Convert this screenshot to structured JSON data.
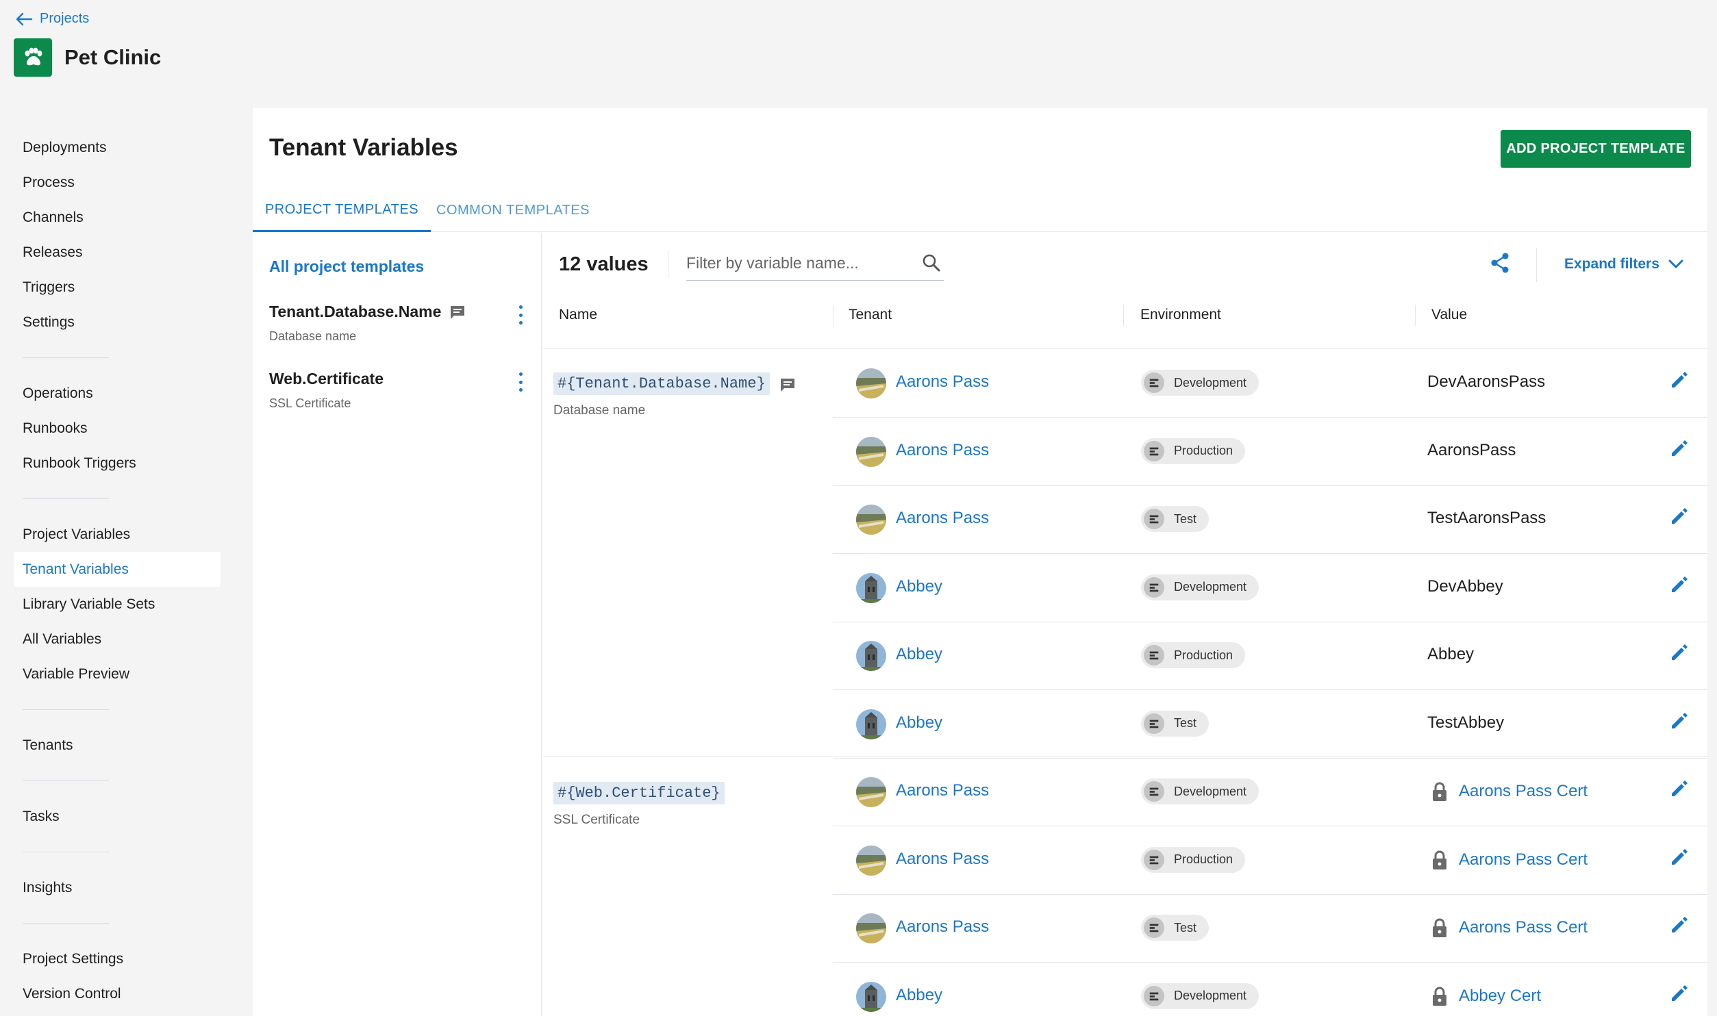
{
  "nav": {
    "back_label": "Projects"
  },
  "project": {
    "name": "Pet Clinic"
  },
  "sidebar": {
    "groups": [
      [
        "Deployments",
        "Process",
        "Channels",
        "Releases",
        "Triggers",
        "Settings"
      ],
      [
        "Operations",
        "Runbooks",
        "Runbook Triggers"
      ],
      [
        "Project Variables",
        "Tenant Variables",
        "Library Variable Sets",
        "All Variables",
        "Variable Preview"
      ],
      [
        "Tenants"
      ],
      [
        "Tasks"
      ],
      [
        "Insights"
      ],
      [
        "Project Settings",
        "Version Control"
      ]
    ],
    "active": "Tenant Variables"
  },
  "page": {
    "title": "Tenant Variables",
    "add_button": "ADD PROJECT TEMPLATE",
    "tabs": [
      "PROJECT TEMPLATES",
      "COMMON TEMPLATES"
    ]
  },
  "templates": {
    "all_label": "All project templates",
    "items": [
      {
        "name": "Tenant.Database.Name",
        "desc": "Database name"
      },
      {
        "name": "Web.Certificate",
        "desc": "SSL Certificate"
      }
    ]
  },
  "values": {
    "count": "12 values",
    "filter_placeholder": "Filter by variable name...",
    "expand_label": "Expand filters",
    "columns": [
      "Name",
      "Tenant",
      "Environment",
      "Value"
    ],
    "groups": [
      {
        "code": "#{Tenant.Database.Name}",
        "desc": "Database name"
      },
      {
        "code": "#{Web.Certificate}",
        "desc": "SSL Certificate"
      }
    ],
    "rows": [
      {
        "tenant": "Aarons Pass",
        "env": "Development",
        "value": "DevAaronsPass",
        "cert": false,
        "avatar": "aarons"
      },
      {
        "tenant": "Aarons Pass",
        "env": "Production",
        "value": "AaronsPass",
        "cert": false,
        "avatar": "aarons"
      },
      {
        "tenant": "Aarons Pass",
        "env": "Test",
        "value": "TestAaronsPass",
        "cert": false,
        "avatar": "aarons"
      },
      {
        "tenant": "Abbey",
        "env": "Development",
        "value": "DevAbbey",
        "cert": false,
        "avatar": "abbey"
      },
      {
        "tenant": "Abbey",
        "env": "Production",
        "value": "Abbey",
        "cert": false,
        "avatar": "abbey"
      },
      {
        "tenant": "Abbey",
        "env": "Test",
        "value": "TestAbbey",
        "cert": false,
        "avatar": "abbey"
      },
      {
        "tenant": "Aarons Pass",
        "env": "Development",
        "value": "Aarons Pass Cert",
        "cert": true,
        "avatar": "aarons"
      },
      {
        "tenant": "Aarons Pass",
        "env": "Production",
        "value": "Aarons Pass Cert",
        "cert": true,
        "avatar": "aarons"
      },
      {
        "tenant": "Aarons Pass",
        "env": "Test",
        "value": "Aarons Pass Cert",
        "cert": true,
        "avatar": "aarons"
      },
      {
        "tenant": "Abbey",
        "env": "Development",
        "value": "Abbey Cert",
        "cert": true,
        "avatar": "abbey"
      }
    ]
  },
  "colors": {
    "accent": "#1a77ca",
    "brand": "#0b8a4b"
  }
}
